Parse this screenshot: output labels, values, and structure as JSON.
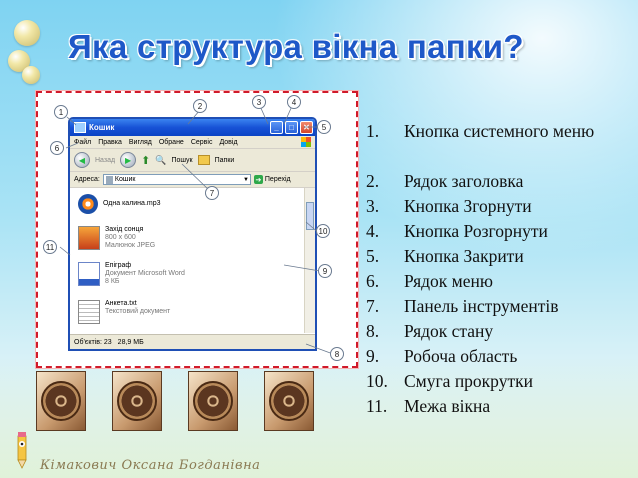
{
  "slide": {
    "title": "Яка структура вікна папки?",
    "author": "Кімакович Оксана Богданівна"
  },
  "window": {
    "title": "Кошик",
    "menu": [
      "Файл",
      "Правка",
      "Вигляд",
      "Обране",
      "Сервіс",
      "Довід"
    ],
    "toolbar": {
      "back": "Назад",
      "search": "Пошук",
      "folders": "Папки"
    },
    "address_label": "Адреса:",
    "address_value": "Кошик",
    "go_label": "Перехід",
    "files": [
      {
        "name": "Одна калина.mp3",
        "info1": "",
        "info2": ""
      },
      {
        "name": "Захід сонця",
        "info1": "800 x 600",
        "info2": "Малюнок JPEG"
      },
      {
        "name": "Епіграф",
        "info1": "Документ Microsoft Word",
        "info2": "8 КБ"
      },
      {
        "name": "Анкета.txt",
        "info1": "Текстовий документ",
        "info2": ""
      }
    ],
    "status_objects": "Об'єктів: 23",
    "status_size": "28,9 МБ"
  },
  "callouts": [
    "1",
    "2",
    "3",
    "4",
    "5",
    "6",
    "7",
    "8",
    "9",
    "10",
    "11"
  ],
  "legend": [
    {
      "n": "1.",
      "text": "Кнопка системного меню"
    },
    {
      "n": "2.",
      "text": "Рядок заголовка"
    },
    {
      "n": "3.",
      "text": "Кнопка Згорнути"
    },
    {
      "n": "4.",
      "text": "Кнопка Розгорнути"
    },
    {
      "n": "5.",
      "text": "Кнопка Закрити"
    },
    {
      "n": "6.",
      "text": "Рядок меню"
    },
    {
      "n": "7.",
      "text": "Панель інструментів"
    },
    {
      "n": "8.",
      "text": "Рядок стану"
    },
    {
      "n": "9.",
      "text": "Робоча область"
    },
    {
      "n": "10.",
      "text": "Смуга прокрутки"
    },
    {
      "n": "11.",
      "text": "Межа вікна"
    }
  ],
  "colors": {
    "title": "#1e58c8",
    "frame_border": "#d11a2a",
    "window_titlebar": "#1752d6"
  }
}
